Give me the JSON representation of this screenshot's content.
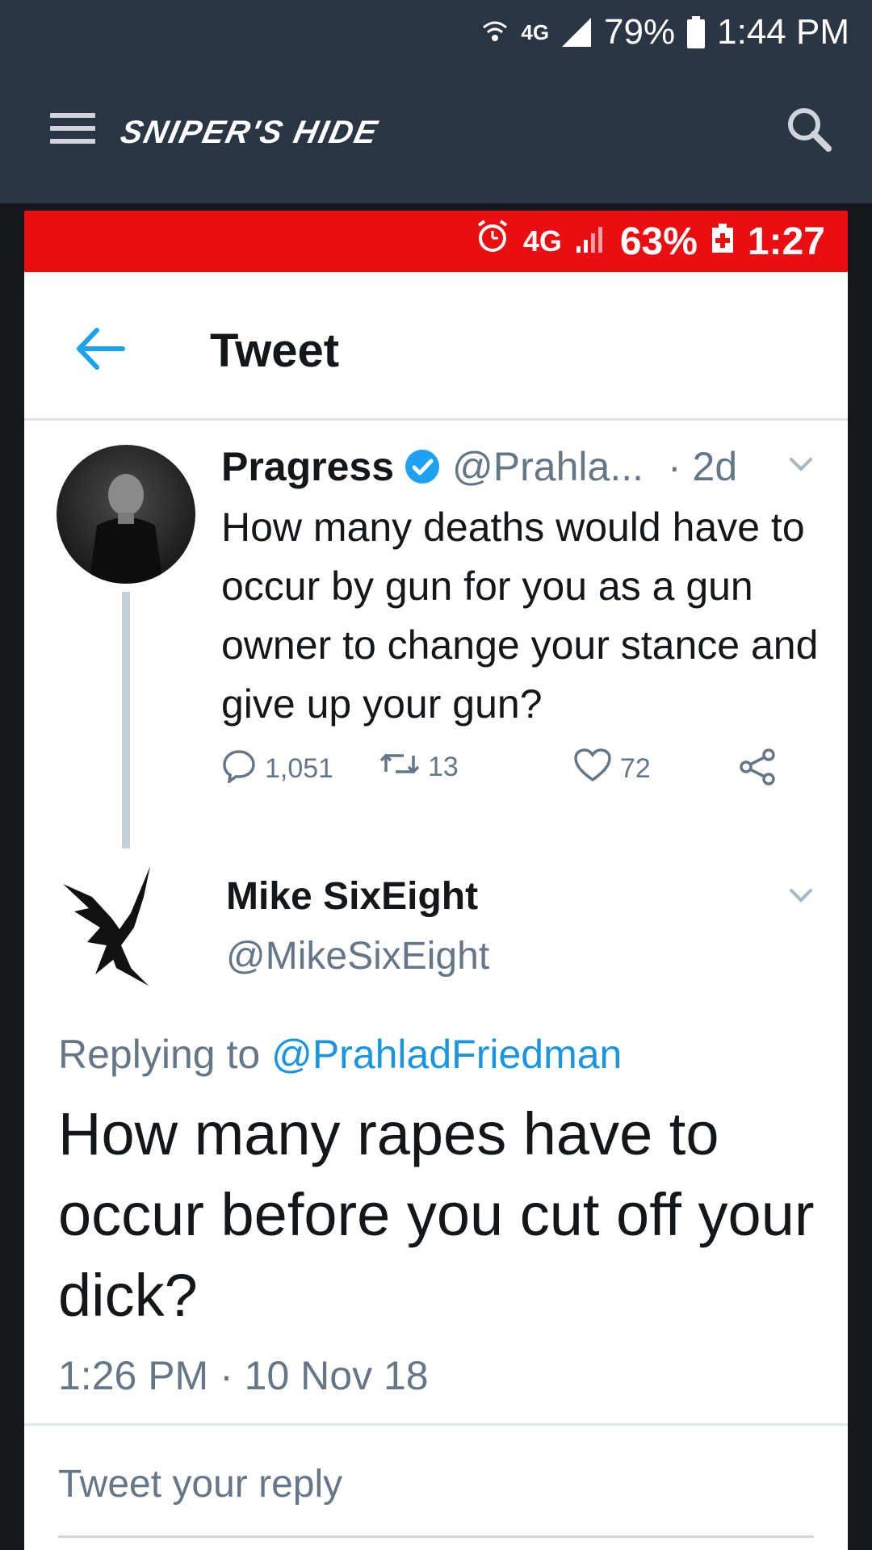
{
  "outer_status": {
    "network": "4G",
    "battery": "79%",
    "time": "1:44 PM"
  },
  "appbar": {
    "logo": "SNIPER'S HIDE"
  },
  "inner_status": {
    "network": "4G",
    "battery": "63%",
    "time": "1:27",
    "accent": "#ea0d12"
  },
  "header": {
    "title": "Tweet"
  },
  "tweet1": {
    "name": "Pragress",
    "handle": "@Prahla...",
    "time": "· 2d",
    "text": "How many deaths would have to occur by gun for you as a gun owner to change your stance and give up your gun?",
    "replies": "1,051",
    "retweets": "13",
    "likes": "72"
  },
  "tweet2": {
    "name": "Mike SixEight",
    "handle": "@MikeSixEight",
    "replying_prefix": "Replying to",
    "replying_to": "@PrahladFriedman",
    "text": "How many rapes have to occur before you cut off your dick?",
    "timestamp": "1:26 PM · 10 Nov 18"
  },
  "reply": {
    "placeholder": "Tweet your reply"
  },
  "colors": {
    "appbar": "#2b3644",
    "link": "#1b95e0",
    "verified": "#1da1f2"
  }
}
